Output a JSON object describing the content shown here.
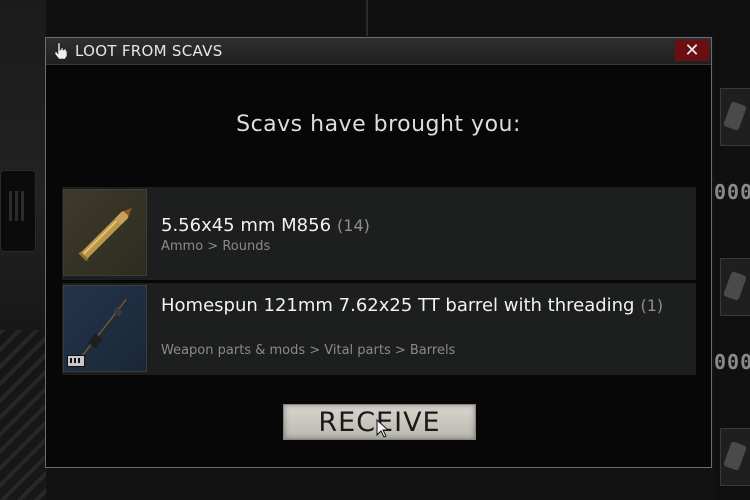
{
  "modal": {
    "title": "LOOT FROM SCAVS",
    "close_label": "✕",
    "heading": "Scavs have brought you:",
    "items": [
      {
        "name": "5.56x45 mm M856",
        "count": "(14)",
        "category": "Ammo > Rounds",
        "icon": "ammo-round-icon"
      },
      {
        "name": "Homespun 121mm 7.62x25 TT barrel with threading",
        "count": "(1)",
        "category": "Weapon parts & mods > Vital parts > Barrels",
        "icon": "barrel-icon"
      }
    ],
    "receive_label": "RECEIVE"
  },
  "background": {
    "side_numbers": [
      "000",
      "000",
      "000"
    ]
  },
  "colors": {
    "close_bg": "#6b0f12",
    "receive_bg": "#d0cec6",
    "row_bg": "#1d1e1e",
    "ammo_thumb": "#3d3a2c",
    "barrel_thumb": "#23344a"
  }
}
